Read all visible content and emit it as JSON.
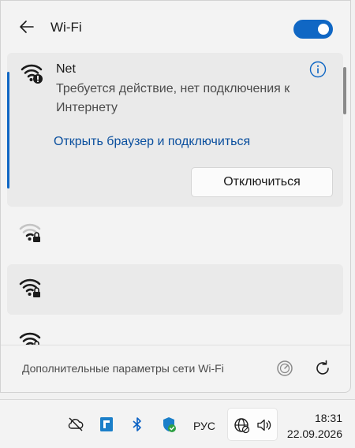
{
  "header": {
    "title": "Wi-Fi",
    "toggle_on": true
  },
  "active_network": {
    "name": "Net",
    "status": "Требуется действие, нет подключения к Интернету",
    "browser_link": "Открыть браузер и подключиться",
    "disconnect_label": "Отключиться"
  },
  "networks": [
    {
      "icon": "wifi-weak-secured-icon"
    },
    {
      "icon": "wifi-full-secured-icon"
    },
    {
      "icon": "wifi-full-secured-icon"
    }
  ],
  "footer": {
    "label": "Дополнительные параметры сети Wi-Fi"
  },
  "taskbar": {
    "language": "РУС",
    "time": "18:31",
    "date": "22.09.2026"
  },
  "colors": {
    "accent": "#1067c4",
    "link": "#0a4f9e"
  }
}
